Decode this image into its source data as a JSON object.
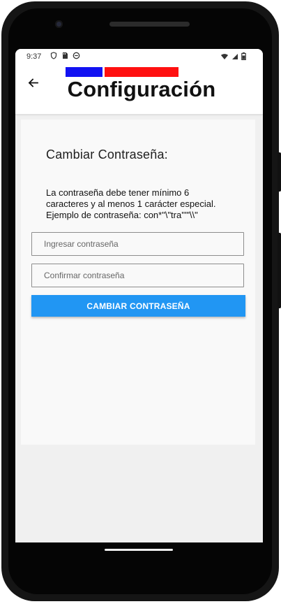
{
  "status_bar": {
    "time": "9:37"
  },
  "header": {
    "title": "Configuración",
    "back_icon": "arrow-left-icon"
  },
  "password_section": {
    "title": "Cambiar Contraseña:",
    "helper_line_1": "La contraseña debe tener mínimo 6",
    "helper_line_2": "caracteres y al menos 1 carácter especial.",
    "helper_line_3": "Ejemplo de contraseña: con*\"\\\"tra'\"\"\\\\\"",
    "new_password_placeholder": "Ingresar contraseña",
    "confirm_password_placeholder": "Confirmar contraseña",
    "submit_label": "CAMBIAR CONTRASEÑA"
  },
  "colors": {
    "accent_blue": "#2196f3",
    "flag_blue": "#1212f2",
    "flag_red": "#ff1010"
  },
  "icons": {
    "status_left": [
      "shield-icon",
      "sd-card-icon",
      "android-icon"
    ],
    "status_right": [
      "wifi-icon",
      "cell-signal-icon",
      "battery-icon"
    ]
  }
}
